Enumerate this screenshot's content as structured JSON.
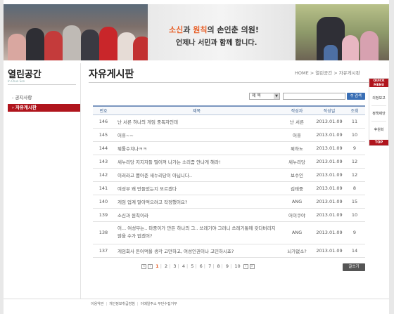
{
  "banner": {
    "slogan_line1_a": "소신",
    "slogan_line1_b": "과 ",
    "slogan_line1_c": "원칙",
    "slogan_line1_d": "의 손인춘 의원!",
    "slogan_line2": "언제나 서민과 함께 합니다."
  },
  "sidebar": {
    "title": "열린공간",
    "subtitle": "In Chun Son",
    "items": [
      {
        "label": "공지사항"
      },
      {
        "label": "자유게시판"
      }
    ]
  },
  "board": {
    "title": "자유게시판",
    "breadcrumb": "HOME > 열린공간 > 자유게시판",
    "search": {
      "select_value": "제 목",
      "button": "검색"
    },
    "columns": [
      "번호",
      "제목",
      "작성자",
      "작성일",
      "조회"
    ],
    "rows": [
      {
        "no": "146",
        "title": "난 서른 하나의 게임 중독자인데",
        "author": "난 서른",
        "date": "2013.01.09",
        "views": "11"
      },
      {
        "no": "145",
        "title": "어휴~~",
        "author": "어휴",
        "date": "2013.01.09",
        "views": "10"
      },
      {
        "no": "144",
        "title": "뭐톨수치나ㅋㅋ",
        "author": "뤽하노",
        "date": "2013.01.09",
        "views": "9"
      },
      {
        "no": "143",
        "title": "새누리당 지지자들 떨어져 나가는 소리좀 안나게 해라!",
        "author": "새누리당",
        "date": "2013.01.09",
        "views": "12"
      },
      {
        "no": "142",
        "title": "이러라고 뽑아준 새누리당이 아닙니다..",
        "author": "보수인",
        "date": "2013.01.09",
        "views": "12"
      },
      {
        "no": "141",
        "title": "여성부 왜 만들었는지 모르겠다",
        "author": "김태중",
        "date": "2013.01.09",
        "views": "8"
      },
      {
        "no": "140",
        "title": "게임 업계 말아먹으려고 작정했어요?",
        "author": "ANG",
        "date": "2013.01.09",
        "views": "15"
      },
      {
        "no": "139",
        "title": "소신과 원칙이라",
        "author": "어이쿠야",
        "date": "2013.01.09",
        "views": "10"
      },
      {
        "no": "138",
        "title": "어... 여성부는.. 마중이가 만든 하나의 그.. 쓰레기야 그러니 쓰레기통에 갖다버리지 않을 수가 없겠어?",
        "author": "ANG",
        "date": "2013.01.09",
        "views": "9",
        "tall": true
      },
      {
        "no": "137",
        "title": "게임회사 돈어먹을 생각 고만하고, 여성인권이나 고민하시죠?",
        "author": "뇌가없소?",
        "date": "2013.01.09",
        "views": "14"
      }
    ],
    "pager": {
      "pages": [
        "1",
        "2",
        "3",
        "4",
        "5",
        "6",
        "7",
        "8",
        "9",
        "10"
      ],
      "current": "1"
    },
    "write_button": "글쓰기"
  },
  "footer": {
    "links": [
      "이용약관",
      "개인정보취급방침",
      "이메일주소 무단수집거부"
    ]
  },
  "quick": {
    "head": "QUICK MENU",
    "items": [
      "의정보고",
      "정책제안",
      "후원회"
    ],
    "top": "TOP"
  }
}
